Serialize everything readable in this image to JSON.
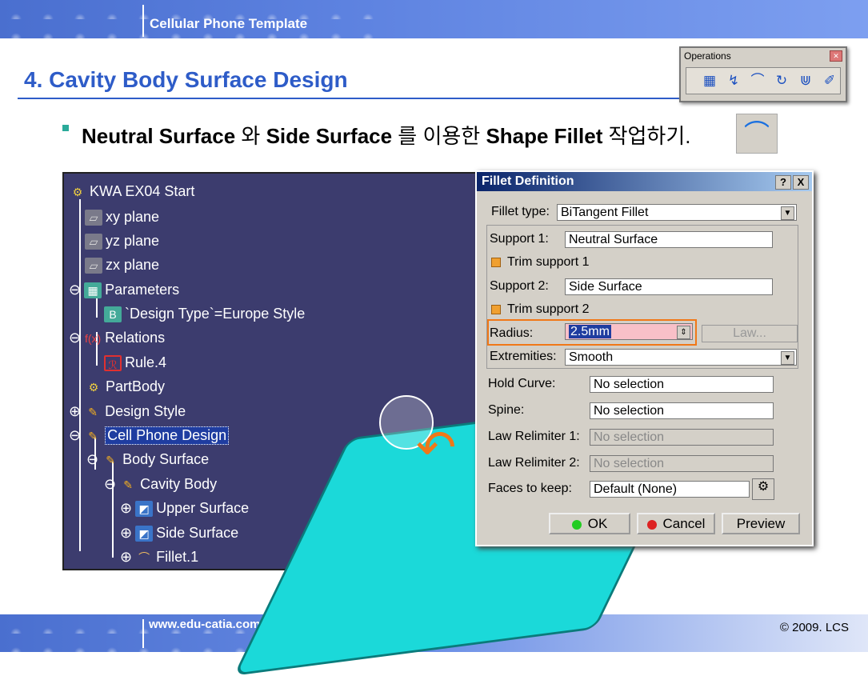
{
  "header": {
    "title": "Cellular Phone Template"
  },
  "footer": {
    "url": "www.edu-catia.com",
    "copyright": "© 2009. LCS"
  },
  "slide": {
    "heading": "4. Cavity Body Surface Design"
  },
  "operations_toolbar": {
    "title": "Operations",
    "tools": [
      "join-icon",
      "untrim-icon",
      "fillet-icon",
      "translate-icon",
      "extrapolate-icon",
      "disassemble-icon"
    ]
  },
  "bullet": {
    "b1": "Neutral Surface",
    "t1": " 와 ",
    "b2": "Side Surface",
    "t2": " 를 이용한 ",
    "b3": "Shape Fillet",
    "t3": " 작업하기."
  },
  "tree": {
    "items": [
      {
        "label": "KWA EX04 Start"
      },
      {
        "label": "xy plane"
      },
      {
        "label": "yz plane"
      },
      {
        "label": "zx plane"
      },
      {
        "label": "Parameters"
      },
      {
        "label": "`Design Type`=Europe Style"
      },
      {
        "label": "Relations"
      },
      {
        "label": "Rule.4"
      },
      {
        "label": "PartBody"
      },
      {
        "label": "Design Style"
      },
      {
        "label": "Cell Phone Design"
      },
      {
        "label": "Body Surface"
      },
      {
        "label": "Cavity Body"
      },
      {
        "label": "Upper Surface"
      },
      {
        "label": "Side Surface"
      },
      {
        "label": "Fillet.1"
      }
    ]
  },
  "dialog": {
    "title": "Fillet Definition",
    "help": "?",
    "close": "X",
    "fillet_type_label": "Fillet type:",
    "fillet_type_value": "BiTangent Fillet",
    "support1_label": "Support 1:",
    "support1_value": "Neutral Surface",
    "trim1_label": "Trim support 1",
    "support2_label": "Support 2:",
    "support2_value": "Side Surface",
    "trim2_label": "Trim support 2",
    "radius_label": "Radius:",
    "radius_value": "2.5mm",
    "law_button": "Law...",
    "extremities_label": "Extremities:",
    "extremities_value": "Smooth",
    "hold_curve_label": "Hold Curve:",
    "hold_curve_value": "No selection",
    "spine_label": "Spine:",
    "spine_value": "No selection",
    "law_rel1_label": "Law Relimiter 1:",
    "law_rel1_value": "No selection",
    "law_rel2_label": "Law Relimiter 2:",
    "law_rel2_value": "No selection",
    "faces_label": "Faces to keep:",
    "faces_value": "Default (None)",
    "ok": "OK",
    "cancel": "Cancel",
    "preview": "Preview"
  },
  "colors": {
    "heading": "#2e5cc8",
    "highlight": "#f07818",
    "viewport": "#3c3c6e",
    "surface": "#1bd9d9"
  }
}
